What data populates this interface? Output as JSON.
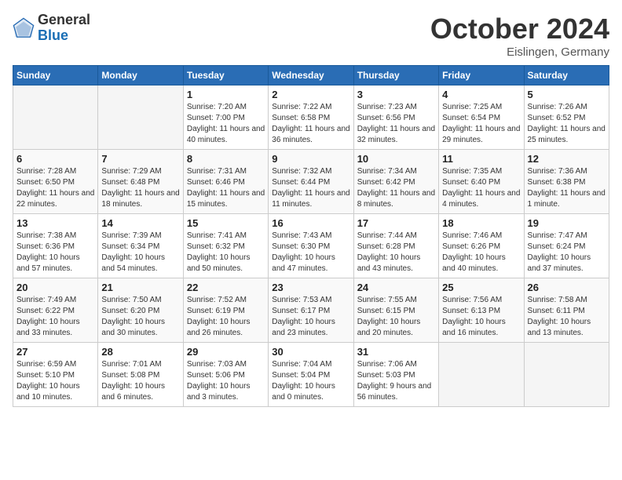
{
  "header": {
    "logo_general": "General",
    "logo_blue": "Blue",
    "month_title": "October 2024",
    "subtitle": "Eislingen, Germany"
  },
  "weekdays": [
    "Sunday",
    "Monday",
    "Tuesday",
    "Wednesday",
    "Thursday",
    "Friday",
    "Saturday"
  ],
  "weeks": [
    [
      {
        "day": "",
        "sunrise": "",
        "sunset": "",
        "daylight": ""
      },
      {
        "day": "",
        "sunrise": "",
        "sunset": "",
        "daylight": ""
      },
      {
        "day": "1",
        "sunrise": "Sunrise: 7:20 AM",
        "sunset": "Sunset: 7:00 PM",
        "daylight": "Daylight: 11 hours and 40 minutes."
      },
      {
        "day": "2",
        "sunrise": "Sunrise: 7:22 AM",
        "sunset": "Sunset: 6:58 PM",
        "daylight": "Daylight: 11 hours and 36 minutes."
      },
      {
        "day": "3",
        "sunrise": "Sunrise: 7:23 AM",
        "sunset": "Sunset: 6:56 PM",
        "daylight": "Daylight: 11 hours and 32 minutes."
      },
      {
        "day": "4",
        "sunrise": "Sunrise: 7:25 AM",
        "sunset": "Sunset: 6:54 PM",
        "daylight": "Daylight: 11 hours and 29 minutes."
      },
      {
        "day": "5",
        "sunrise": "Sunrise: 7:26 AM",
        "sunset": "Sunset: 6:52 PM",
        "daylight": "Daylight: 11 hours and 25 minutes."
      }
    ],
    [
      {
        "day": "6",
        "sunrise": "Sunrise: 7:28 AM",
        "sunset": "Sunset: 6:50 PM",
        "daylight": "Daylight: 11 hours and 22 minutes."
      },
      {
        "day": "7",
        "sunrise": "Sunrise: 7:29 AM",
        "sunset": "Sunset: 6:48 PM",
        "daylight": "Daylight: 11 hours and 18 minutes."
      },
      {
        "day": "8",
        "sunrise": "Sunrise: 7:31 AM",
        "sunset": "Sunset: 6:46 PM",
        "daylight": "Daylight: 11 hours and 15 minutes."
      },
      {
        "day": "9",
        "sunrise": "Sunrise: 7:32 AM",
        "sunset": "Sunset: 6:44 PM",
        "daylight": "Daylight: 11 hours and 11 minutes."
      },
      {
        "day": "10",
        "sunrise": "Sunrise: 7:34 AM",
        "sunset": "Sunset: 6:42 PM",
        "daylight": "Daylight: 11 hours and 8 minutes."
      },
      {
        "day": "11",
        "sunrise": "Sunrise: 7:35 AM",
        "sunset": "Sunset: 6:40 PM",
        "daylight": "Daylight: 11 hours and 4 minutes."
      },
      {
        "day": "12",
        "sunrise": "Sunrise: 7:36 AM",
        "sunset": "Sunset: 6:38 PM",
        "daylight": "Daylight: 11 hours and 1 minute."
      }
    ],
    [
      {
        "day": "13",
        "sunrise": "Sunrise: 7:38 AM",
        "sunset": "Sunset: 6:36 PM",
        "daylight": "Daylight: 10 hours and 57 minutes."
      },
      {
        "day": "14",
        "sunrise": "Sunrise: 7:39 AM",
        "sunset": "Sunset: 6:34 PM",
        "daylight": "Daylight: 10 hours and 54 minutes."
      },
      {
        "day": "15",
        "sunrise": "Sunrise: 7:41 AM",
        "sunset": "Sunset: 6:32 PM",
        "daylight": "Daylight: 10 hours and 50 minutes."
      },
      {
        "day": "16",
        "sunrise": "Sunrise: 7:43 AM",
        "sunset": "Sunset: 6:30 PM",
        "daylight": "Daylight: 10 hours and 47 minutes."
      },
      {
        "day": "17",
        "sunrise": "Sunrise: 7:44 AM",
        "sunset": "Sunset: 6:28 PM",
        "daylight": "Daylight: 10 hours and 43 minutes."
      },
      {
        "day": "18",
        "sunrise": "Sunrise: 7:46 AM",
        "sunset": "Sunset: 6:26 PM",
        "daylight": "Daylight: 10 hours and 40 minutes."
      },
      {
        "day": "19",
        "sunrise": "Sunrise: 7:47 AM",
        "sunset": "Sunset: 6:24 PM",
        "daylight": "Daylight: 10 hours and 37 minutes."
      }
    ],
    [
      {
        "day": "20",
        "sunrise": "Sunrise: 7:49 AM",
        "sunset": "Sunset: 6:22 PM",
        "daylight": "Daylight: 10 hours and 33 minutes."
      },
      {
        "day": "21",
        "sunrise": "Sunrise: 7:50 AM",
        "sunset": "Sunset: 6:20 PM",
        "daylight": "Daylight: 10 hours and 30 minutes."
      },
      {
        "day": "22",
        "sunrise": "Sunrise: 7:52 AM",
        "sunset": "Sunset: 6:19 PM",
        "daylight": "Daylight: 10 hours and 26 minutes."
      },
      {
        "day": "23",
        "sunrise": "Sunrise: 7:53 AM",
        "sunset": "Sunset: 6:17 PM",
        "daylight": "Daylight: 10 hours and 23 minutes."
      },
      {
        "day": "24",
        "sunrise": "Sunrise: 7:55 AM",
        "sunset": "Sunset: 6:15 PM",
        "daylight": "Daylight: 10 hours and 20 minutes."
      },
      {
        "day": "25",
        "sunrise": "Sunrise: 7:56 AM",
        "sunset": "Sunset: 6:13 PM",
        "daylight": "Daylight: 10 hours and 16 minutes."
      },
      {
        "day": "26",
        "sunrise": "Sunrise: 7:58 AM",
        "sunset": "Sunset: 6:11 PM",
        "daylight": "Daylight: 10 hours and 13 minutes."
      }
    ],
    [
      {
        "day": "27",
        "sunrise": "Sunrise: 6:59 AM",
        "sunset": "Sunset: 5:10 PM",
        "daylight": "Daylight: 10 hours and 10 minutes."
      },
      {
        "day": "28",
        "sunrise": "Sunrise: 7:01 AM",
        "sunset": "Sunset: 5:08 PM",
        "daylight": "Daylight: 10 hours and 6 minutes."
      },
      {
        "day": "29",
        "sunrise": "Sunrise: 7:03 AM",
        "sunset": "Sunset: 5:06 PM",
        "daylight": "Daylight: 10 hours and 3 minutes."
      },
      {
        "day": "30",
        "sunrise": "Sunrise: 7:04 AM",
        "sunset": "Sunset: 5:04 PM",
        "daylight": "Daylight: 10 hours and 0 minutes."
      },
      {
        "day": "31",
        "sunrise": "Sunrise: 7:06 AM",
        "sunset": "Sunset: 5:03 PM",
        "daylight": "Daylight: 9 hours and 56 minutes."
      },
      {
        "day": "",
        "sunrise": "",
        "sunset": "",
        "daylight": ""
      },
      {
        "day": "",
        "sunrise": "",
        "sunset": "",
        "daylight": ""
      }
    ]
  ]
}
